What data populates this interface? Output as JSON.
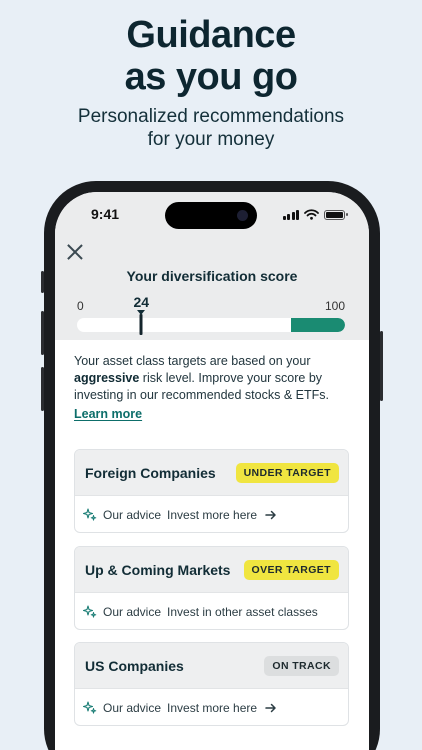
{
  "headline": {
    "line1": "Guidance",
    "line2": "as you go"
  },
  "subhead": {
    "line1": "Personalized recommendations",
    "line2": "for your money"
  },
  "status_bar": {
    "time": "9:41"
  },
  "score": {
    "title": "Your diversification score",
    "min_label": "0",
    "max_label": "100",
    "value_label": "24",
    "value": 24,
    "target_start": 80,
    "target_color": "#1a8b72"
  },
  "intro": {
    "text_before": "Your asset class targets are based on your ",
    "bold": "aggressive",
    "text_after": " risk level. Improve your score by investing in our recommended stocks & ETFs.",
    "link": "Learn more"
  },
  "cards": [
    {
      "title": "Foreign Companies",
      "badge": "UNDER TARGET",
      "badge_type": "warn",
      "advice_label": "Our advice",
      "advice_text": "Invest more here",
      "has_arrow": true
    },
    {
      "title": "Up & Coming Markets",
      "badge": "OVER TARGET",
      "badge_type": "warn",
      "advice_label": "Our advice",
      "advice_text": "Invest in other asset classes",
      "has_arrow": false
    },
    {
      "title": "US Companies",
      "badge": "ON TRACK",
      "badge_type": "ok",
      "advice_label": "Our advice",
      "advice_text": "Invest more here",
      "has_arrow": true
    }
  ],
  "icons": {
    "close": "close-icon",
    "sparkle": "sparkle-icon",
    "arrow": "arrow-right-icon"
  },
  "colors": {
    "warn_badge": "#f0e540",
    "link": "#0d6e6a",
    "background": "#e8eff6"
  }
}
